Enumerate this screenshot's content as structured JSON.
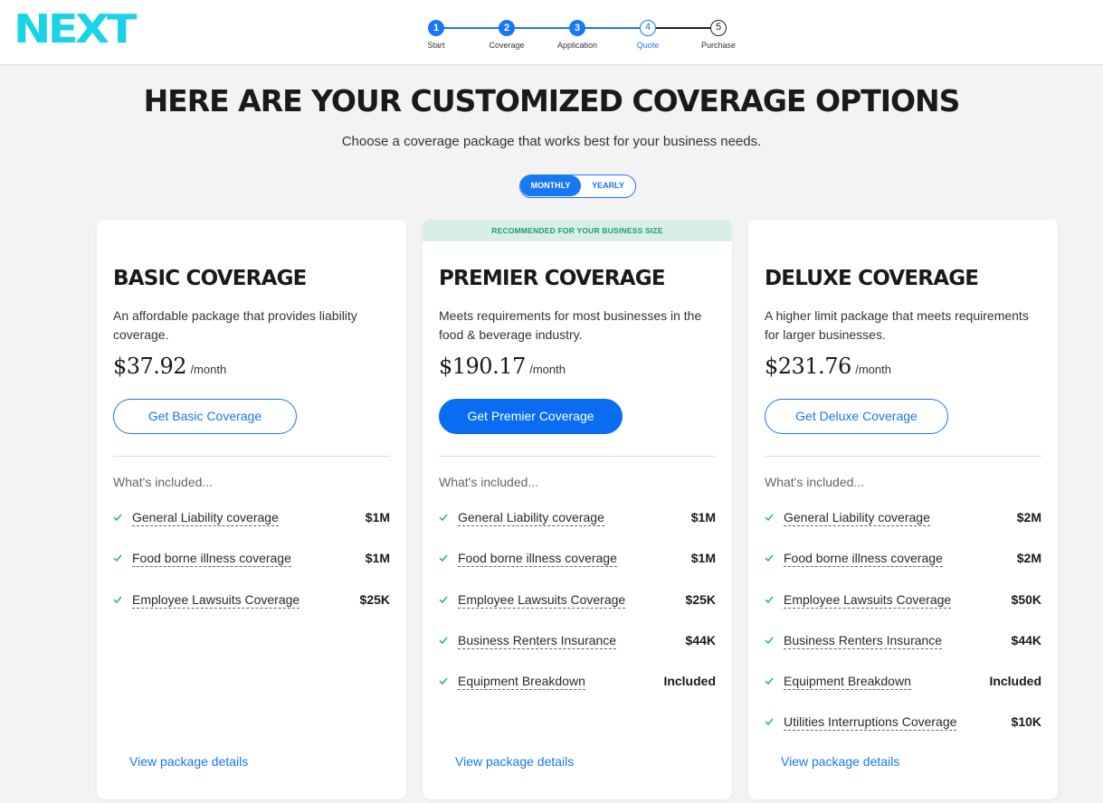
{
  "brand": {
    "logo_text": "NEXT",
    "accent": "#19d3e7",
    "primary": "#1877f2"
  },
  "steps": [
    {
      "num": "1",
      "label": "Start",
      "state": "done"
    },
    {
      "num": "2",
      "label": "Coverage",
      "state": "done"
    },
    {
      "num": "3",
      "label": "Application",
      "state": "done"
    },
    {
      "num": "4",
      "label": "Quote",
      "state": "current"
    },
    {
      "num": "5",
      "label": "Purchase",
      "state": "todo"
    }
  ],
  "headline": "HERE ARE YOUR CUSTOMIZED COVERAGE OPTIONS",
  "subhead": "Choose a coverage package that works best for your business needs.",
  "billing_toggle": {
    "monthly": "MONTHLY",
    "yearly": "YEARLY",
    "selected": "MONTHLY"
  },
  "included_label": "What's included...",
  "details_link": "View package details",
  "plans": [
    {
      "title": "BASIC COVERAGE",
      "description": "An affordable package that provides liability coverage.",
      "price": "$37.92",
      "period": "/month",
      "cta": "Get Basic Coverage",
      "features": [
        {
          "name": "General Liability coverage",
          "value": "$1M"
        },
        {
          "name": "Food borne illness coverage",
          "value": "$1M"
        },
        {
          "name": "Employee Lawsuits Coverage",
          "value": "$25K"
        }
      ]
    },
    {
      "ribbon": "RECOMMENDED FOR YOUR BUSINESS SIZE",
      "title": "PREMIER COVERAGE",
      "description": "Meets requirements for most businesses in the food & beverage industry.",
      "price": "$190.17",
      "period": "/month",
      "cta": "Get Premier Coverage",
      "features": [
        {
          "name": "General Liability coverage",
          "value": "$1M"
        },
        {
          "name": "Food borne illness coverage",
          "value": "$1M"
        },
        {
          "name": "Employee Lawsuits Coverage",
          "value": "$25K"
        },
        {
          "name": "Business Renters Insurance",
          "value": "$44K"
        },
        {
          "name": "Equipment Breakdown",
          "value": "Included"
        }
      ]
    },
    {
      "title": "DELUXE COVERAGE",
      "description": "A higher limit package that meets requirements for larger businesses.",
      "price": "$231.76",
      "period": "/month",
      "cta": "Get Deluxe Coverage",
      "features": [
        {
          "name": "General Liability coverage",
          "value": "$2M"
        },
        {
          "name": "Food borne illness coverage",
          "value": "$2M"
        },
        {
          "name": "Employee Lawsuits Coverage",
          "value": "$50K"
        },
        {
          "name": "Business Renters Insurance",
          "value": "$44K"
        },
        {
          "name": "Equipment Breakdown",
          "value": "Included"
        },
        {
          "name": "Utilities Interruptions Coverage",
          "value": "$10K"
        }
      ]
    }
  ]
}
